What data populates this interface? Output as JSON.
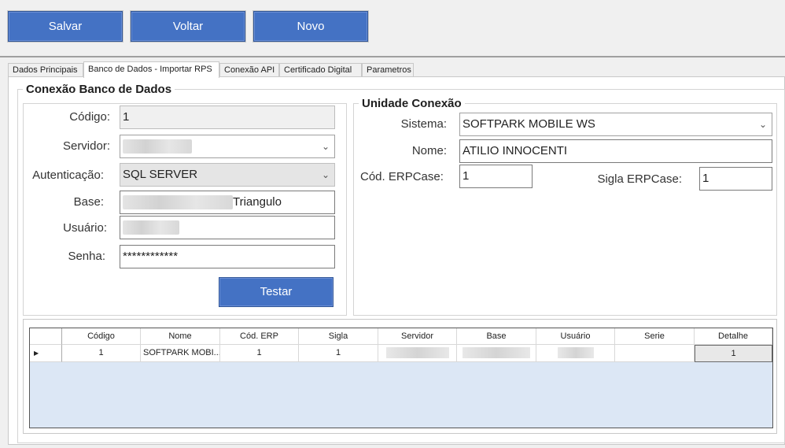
{
  "toolbar": {
    "save": "Salvar",
    "back": "Voltar",
    "new": "Novo"
  },
  "tabs": [
    {
      "label": "Dados Principais",
      "active": false
    },
    {
      "label": "Banco de Dados - Importar RPS",
      "active": true
    },
    {
      "label": "Conexão API",
      "active": false
    },
    {
      "label": "Certificado Digital",
      "active": false
    },
    {
      "label": "Parametros",
      "active": false
    }
  ],
  "db": {
    "title": "Conexão Banco de Dados",
    "codigo_label": "Código:",
    "codigo": "1",
    "servidor_label": "Servidor:",
    "servidor": "",
    "auth_label": "Autenticação:",
    "auth": "SQL SERVER",
    "base_label": "Base:",
    "base": "Triangulo",
    "usuario_label": "Usuário:",
    "usuario": "",
    "senha_label": "Senha:",
    "senha": "************",
    "test_button": "Testar"
  },
  "unit": {
    "title": "Unidade Conexão",
    "sistema_label": "Sistema:",
    "sistema": "SOFTPARK MOBILE WS",
    "nome_label": "Nome:",
    "nome": "ATILIO INNOCENTI",
    "erp_label": "Cód. ERPCase:",
    "erp": "1",
    "sigla_label": "Sigla ERPCase:",
    "sigla": "1"
  },
  "grid": {
    "columns": [
      "Código",
      "Nome",
      "Cód. ERP",
      "Sigla",
      "Servidor",
      "Base",
      "Usuário",
      "Serie",
      "Detalhe"
    ],
    "row": {
      "codigo": "1",
      "nome": "SOFTPARK MOBI...",
      "cod_erp": "1",
      "sigla": "1",
      "servidor": "",
      "base": "",
      "usuario": "",
      "serie": "",
      "detalhe": "1"
    }
  },
  "icons": {
    "combo": "chevron-down-icon",
    "row_pointer": "row-pointer-icon"
  },
  "colors": {
    "button": "#4472c4",
    "grid_background": "#dce7f5"
  }
}
